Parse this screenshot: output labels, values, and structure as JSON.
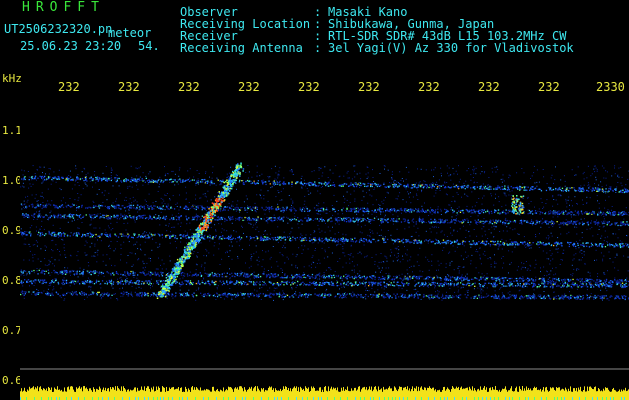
{
  "header": {
    "brand": "HROFFT",
    "filename": "UT2506232320.pn",
    "type": "meteor",
    "datetime": "25.06.23 23:20",
    "count": "54.",
    "fields": [
      {
        "label": "Observer",
        "value": "Masaki Kano"
      },
      {
        "label": "Receiving Location",
        "value": "Shibukawa, Gunma, Japan"
      },
      {
        "label": "Receiver",
        "value": "RTL-SDR SDR# 43dB L15 103.2MHz CW"
      },
      {
        "label": "Receiving Antenna",
        "value": "3el Yagi(V) Az 330 for Vladivostok"
      }
    ]
  },
  "axis": {
    "unit": "kHz",
    "x_ticks": [
      "232",
      "232",
      "232",
      "232",
      "232",
      "232",
      "232",
      "232",
      "232",
      "2330"
    ],
    "y_ticks": [
      "1.1",
      "1.0",
      "0.9",
      "0.8",
      "0.7",
      "0.6"
    ]
  },
  "colors": {
    "text_cyan": "#3ee8f0",
    "title_green": "#39e63a",
    "axis_yellow": "#e8e840",
    "background": "#000000"
  }
}
